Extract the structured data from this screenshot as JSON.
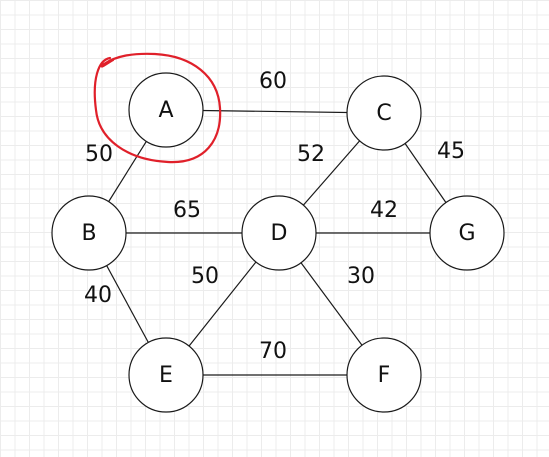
{
  "graph": {
    "nodes": [
      {
        "id": "A",
        "label": "A"
      },
      {
        "id": "B",
        "label": "B"
      },
      {
        "id": "C",
        "label": "C"
      },
      {
        "id": "D",
        "label": "D"
      },
      {
        "id": "E",
        "label": "E"
      },
      {
        "id": "F",
        "label": "F"
      },
      {
        "id": "G",
        "label": "G"
      }
    ],
    "edges": [
      {
        "from": "A",
        "to": "C",
        "weight": "60"
      },
      {
        "from": "A",
        "to": "B",
        "weight": "50"
      },
      {
        "from": "B",
        "to": "D",
        "weight": "65"
      },
      {
        "from": "C",
        "to": "D",
        "weight": "52"
      },
      {
        "from": "C",
        "to": "G",
        "weight": "45"
      },
      {
        "from": "D",
        "to": "G",
        "weight": "42"
      },
      {
        "from": "B",
        "to": "E",
        "weight": "40"
      },
      {
        "from": "D",
        "to": "E",
        "weight": "50"
      },
      {
        "from": "D",
        "to": "F",
        "weight": "30"
      },
      {
        "from": "E",
        "to": "F",
        "weight": "70"
      }
    ],
    "highlighted_node": "A",
    "highlight_color": "#e0202a"
  }
}
